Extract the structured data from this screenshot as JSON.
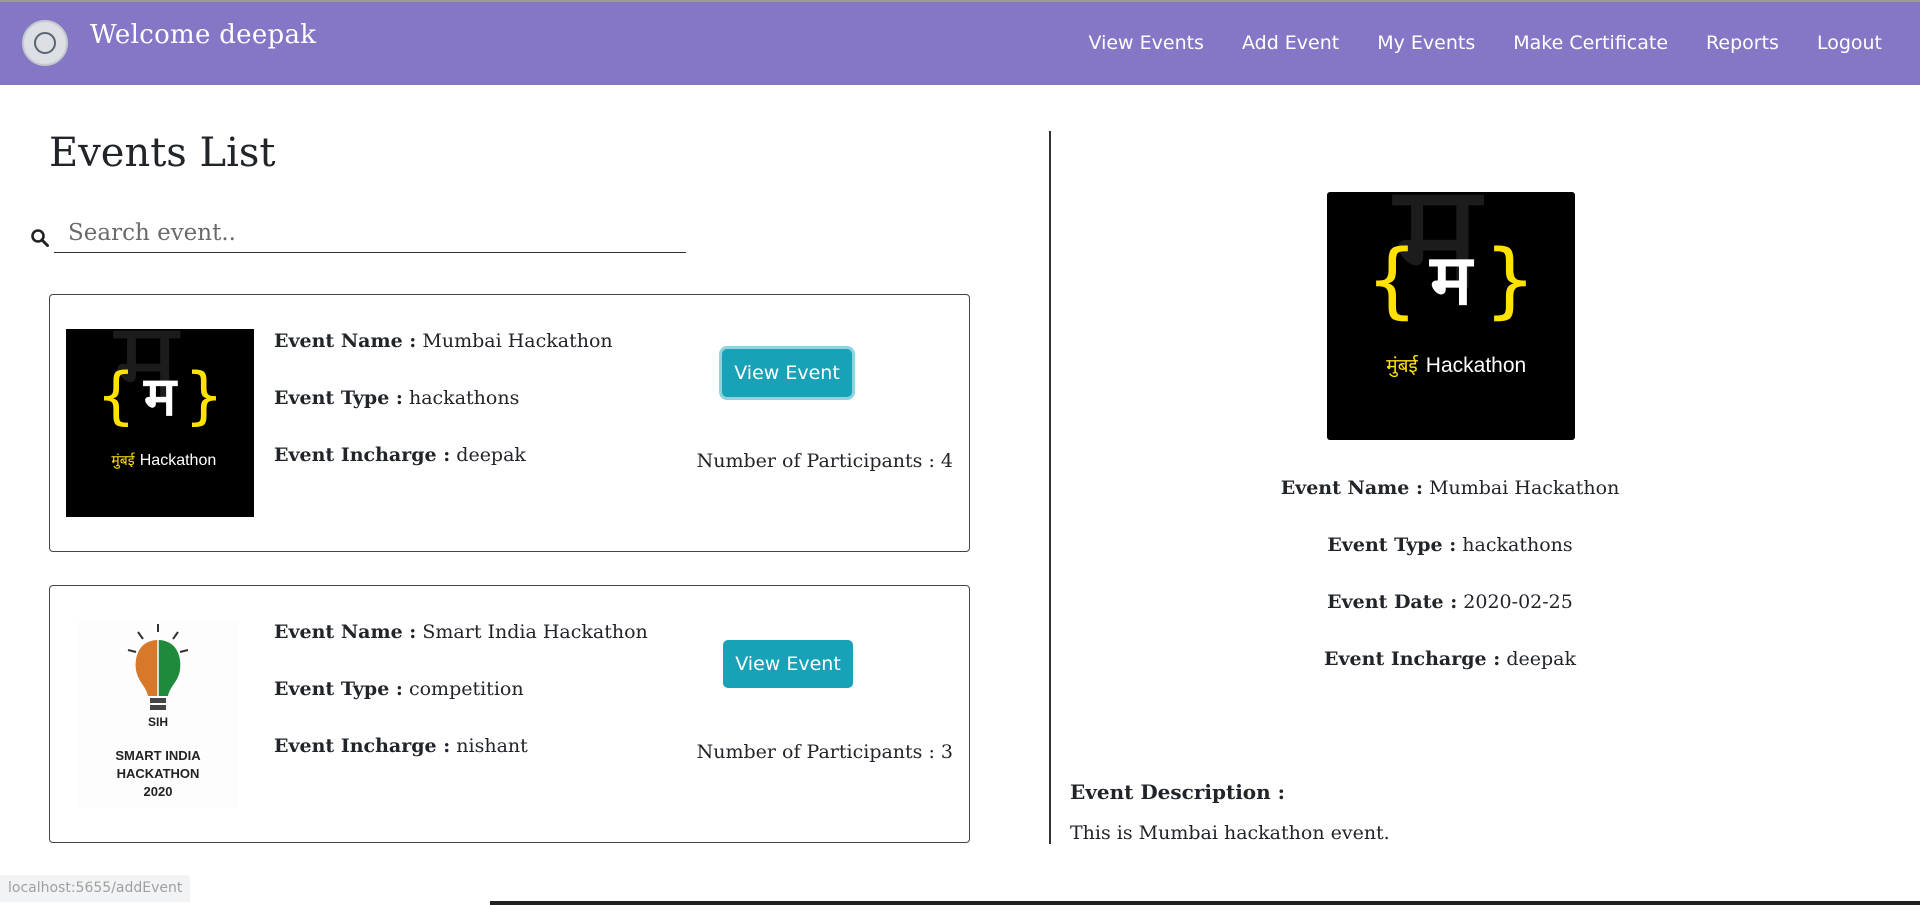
{
  "nav": {
    "brand": "Welcome deepak",
    "links": [
      "View Events",
      "Add Event",
      "My Events",
      "Make Certificate",
      "Reports",
      "Logout"
    ]
  },
  "events_list": {
    "title": "Events List",
    "search": {
      "placeholder": "Search event..",
      "value": ""
    },
    "cards": [
      {
        "name_label": "Event Name :",
        "name": "Mumbai Hackathon",
        "type_label": "Event Type :",
        "type": "hackathons",
        "incharge_label": "Event Incharge :",
        "incharge": "deepak",
        "button": "View Event",
        "participants": "Number of Participants : 4",
        "image_text": {
          "letter": "म",
          "brand_marathi": "मुंबई",
          "brand_en": "Hackathon"
        }
      },
      {
        "name_label": "Event Name :",
        "name": "Smart India Hackathon",
        "type_label": "Event Type :",
        "type": "competition",
        "incharge_label": "Event Incharge :",
        "incharge": "nishant",
        "button": "View Event",
        "participants": "Number of Participants : 3",
        "image_text": {
          "line1": "SMART INDIA",
          "line2": "HACKATHON",
          "line3": "2020",
          "badge": "SIH"
        }
      }
    ]
  },
  "detail": {
    "image_text": {
      "letter": "म",
      "brand_marathi": "मुंबई",
      "brand_en": "Hackathon"
    },
    "name_label": "Event Name :",
    "name": "Mumbai Hackathon",
    "type_label": "Event Type :",
    "type": "hackathons",
    "date_label": "Event Date :",
    "date": "2020-02-25",
    "incharge_label": "Event Incharge :",
    "incharge": "deepak",
    "description_label": "Event Description :",
    "description": "This is Mumbai hackathon event."
  },
  "status_bar": {
    "url": "localhost:5655/addEvent"
  },
  "colors": {
    "navbar": "#8577c5",
    "button": "#17a2b8",
    "brace_yellow": "#ffe200"
  }
}
